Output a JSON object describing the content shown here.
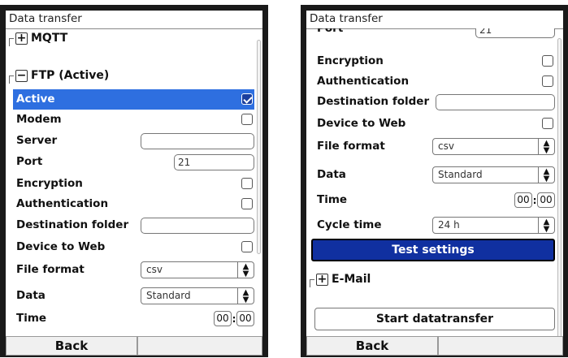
{
  "left_screen": {
    "title": "Data transfer",
    "groups": {
      "mqtt": {
        "expander": "+",
        "label": "MQTT"
      },
      "ftp": {
        "expander": "−",
        "label": "FTP (Active)"
      }
    },
    "rows": {
      "active": {
        "label": "Active",
        "checked": true
      },
      "modem": {
        "label": "Modem",
        "checked": false
      },
      "server": {
        "label": "Server",
        "value": ""
      },
      "port": {
        "label": "Port",
        "value": "21"
      },
      "encryption": {
        "label": "Encryption",
        "checked": false
      },
      "authentication": {
        "label": "Authentication",
        "checked": false
      },
      "destination_folder": {
        "label": "Destination folder",
        "value": ""
      },
      "device_to_web": {
        "label": "Device to Web",
        "checked": false
      },
      "file_format": {
        "label": "File format",
        "value": "csv"
      },
      "data": {
        "label": "Data",
        "value": "Standard"
      },
      "time": {
        "label": "Time",
        "hours": "00",
        "minutes": "00"
      }
    },
    "footer": {
      "back": "Back",
      "right": ""
    }
  },
  "right_screen": {
    "title": "Data transfer",
    "rows": {
      "port": {
        "label": "Port",
        "value": "21"
      },
      "encryption": {
        "label": "Encryption",
        "checked": false
      },
      "authentication": {
        "label": "Authentication",
        "checked": false
      },
      "destination_folder": {
        "label": "Destination folder",
        "value": ""
      },
      "device_to_web": {
        "label": "Device to Web",
        "checked": false
      },
      "file_format": {
        "label": "File format",
        "value": "csv"
      },
      "data": {
        "label": "Data",
        "value": "Standard"
      },
      "time": {
        "label": "Time",
        "hours": "00",
        "minutes": "00"
      },
      "cycle_time": {
        "label": "Cycle time",
        "value": "24 h"
      }
    },
    "test_settings": "Test settings",
    "email_group": {
      "expander": "+",
      "label": "E-Mail"
    },
    "start_datatransfer": "Start datatransfer",
    "footer": {
      "back": "Back",
      "right": ""
    }
  },
  "icons": {
    "spinner": "up-down-arrows",
    "check": "checkmark",
    "expand": "plus",
    "collapse": "minus"
  },
  "colors": {
    "selection": "#2e6fe0",
    "button_blue": "#1030a0",
    "frame": "#1a1a1a"
  }
}
